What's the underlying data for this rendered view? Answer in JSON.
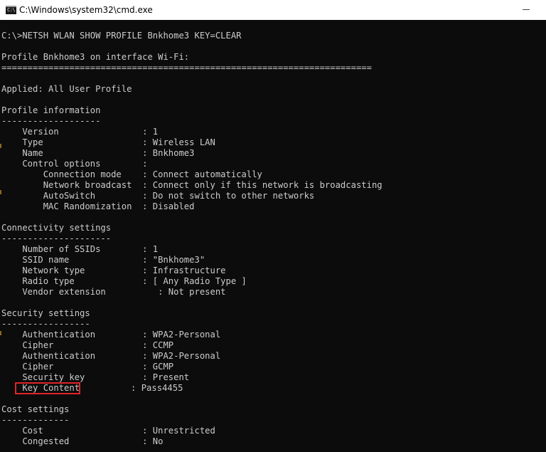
{
  "window": {
    "title": "C:\\Windows\\system32\\cmd.exe",
    "icon_prompt": "C:\\",
    "icon": "command-prompt-icon"
  },
  "console": {
    "command": "C:\\>NETSH WLAN SHOW PROFILE Bnkhome3 KEY=CLEAR",
    "header": "Profile Bnkhome3 on interface Wi-Fi:",
    "header_rule": "=======================================================================",
    "applied": "Applied: All User Profile",
    "profile_info": {
      "heading": "Profile information",
      "rule": "-------------------",
      "rows": [
        "    Version                : 1",
        "    Type                   : Wireless LAN",
        "    Name                   : Bnkhome3",
        "    Control options        :",
        "        Connection mode    : Connect automatically",
        "        Network broadcast  : Connect only if this network is broadcasting",
        "        AutoSwitch         : Do not switch to other networks",
        "        MAC Randomization  : Disabled"
      ]
    },
    "connectivity": {
      "heading": "Connectivity settings",
      "rule": "---------------------",
      "rows": [
        "    Number of SSIDs        : 1",
        "    SSID name              : \"Bnkhome3\"",
        "    Network type           : Infrastructure",
        "    Radio type             : [ Any Radio Type ]",
        "    Vendor extension          : Not present"
      ]
    },
    "security": {
      "heading": "Security settings",
      "rule": "-----------------",
      "rows": [
        "    Authentication         : WPA2-Personal",
        "    Cipher                 : CCMP",
        "    Authentication         : WPA2-Personal",
        "    Cipher                 : GCMP",
        "    Security key           : Present"
      ],
      "key_content_label": "    Key Content",
      "key_content_value": "            : Pass4455"
    },
    "cost": {
      "heading": "Cost settings",
      "rule": "-------------",
      "rows": [
        "    Cost                   : Unrestricted",
        "    Congested              : No"
      ]
    }
  }
}
